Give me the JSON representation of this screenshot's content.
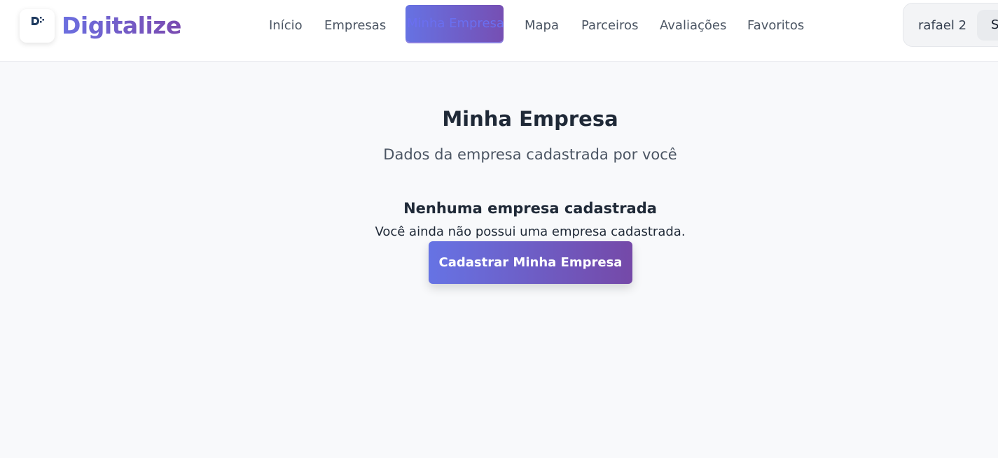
{
  "header": {
    "brand": "Digitalize",
    "logo_icon": "digitalize-logo-icon",
    "nav": [
      {
        "label": "Início"
      },
      {
        "label": "Empresas"
      },
      {
        "label": "Minha Empresa",
        "active": true
      },
      {
        "label": "Mapa"
      },
      {
        "label": "Parceiros"
      },
      {
        "label": "Avaliações"
      },
      {
        "label": "Favoritos"
      }
    ],
    "user": {
      "name": "rafael 2",
      "action_label": "Sair"
    }
  },
  "main": {
    "title": "Minha Empresa",
    "subtitle": "Dados da empresa cadastrada por você",
    "empty": {
      "title": "Nenhuma empresa cadastrada",
      "text": "Você ainda não possui uma empresa cadastrada.",
      "button_label": "Cadastrar Minha Empresa"
    }
  },
  "colors": {
    "accent_start": "#6673e4",
    "accent_end": "#7549a8",
    "background": "#f8f9fb"
  }
}
